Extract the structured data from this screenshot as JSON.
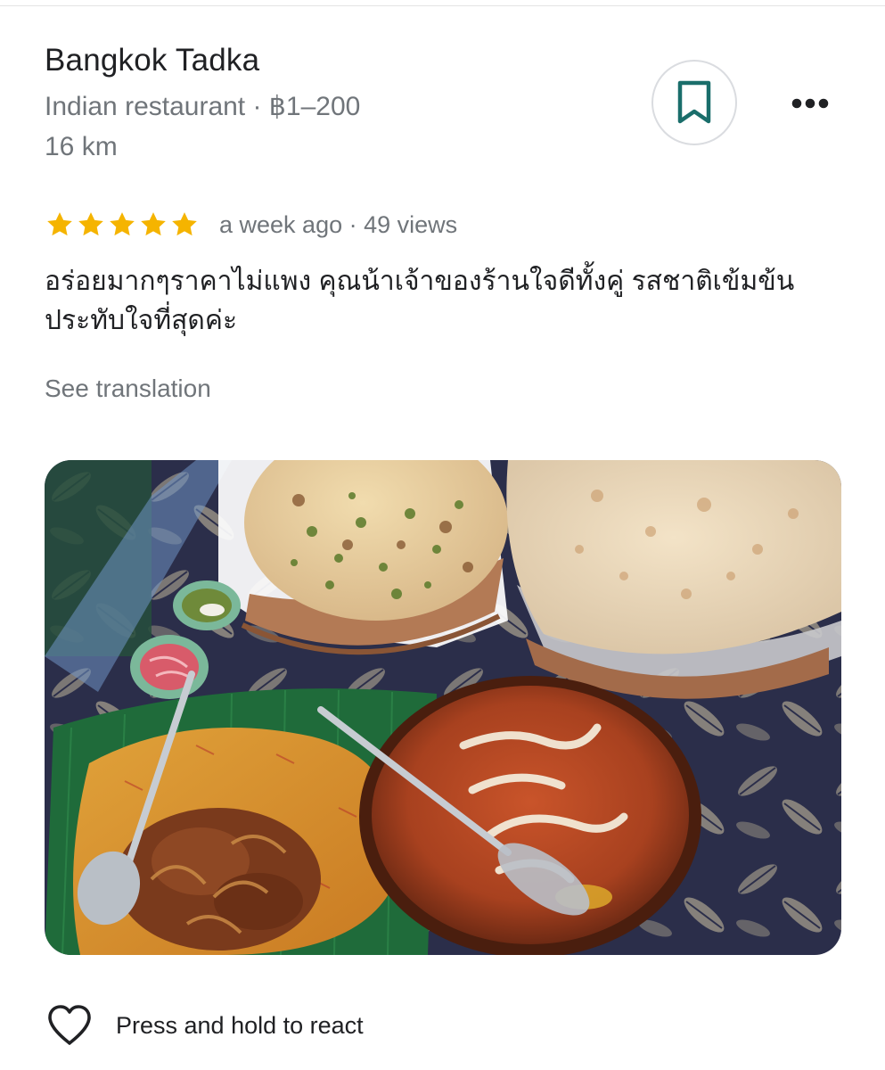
{
  "place": {
    "name": "Bangkok Tadka",
    "category_price": "Indian restaurant · ฿1–200",
    "distance": "16 km"
  },
  "actions": {
    "save_icon": "bookmark-icon",
    "more_icon": "more-horizontal-icon"
  },
  "review": {
    "stars": 5,
    "star_color": "#f5b400",
    "meta": "a week ago · 49 views",
    "text": "อร่อยมากๆราคาไม่แพง คุณน้าเจ้าของร้านใจดีทั้งคู่ รสชาติเข้มข้น ประทับใจที่สุดค่ะ",
    "see_translation": "See translation"
  },
  "footer": {
    "react_icon": "heart-icon",
    "react_label": "Press and hold to react"
  },
  "colors": {
    "accent": "#1a6e6b",
    "secondary_text": "#70757a",
    "primary_text": "#202124"
  }
}
